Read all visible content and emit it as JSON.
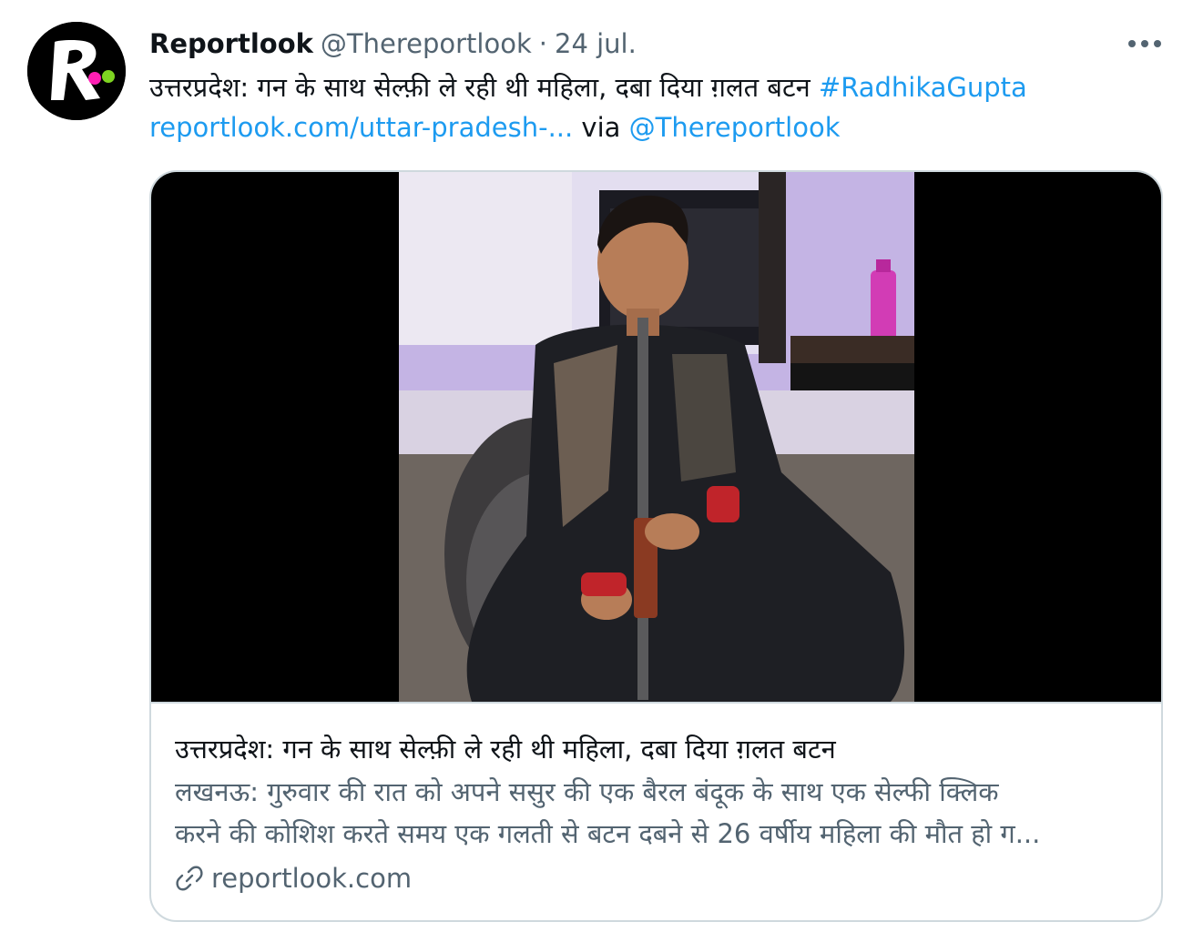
{
  "tweet": {
    "display_name": "Reportlook",
    "handle": "@Thereportlook",
    "separator": "·",
    "date": "24 jul.",
    "text_line1_plain": "उत्तरप्रदेश: गन के साथ सेल्फ़ी ले रही थी महिला, दबा दिया ग़लत बटन ",
    "text_line1_hashtag": "#RadhikaGupta",
    "text_line2_link": "reportlook.com/uttar-pradesh-...",
    "text_line2_via": " via ",
    "text_line2_mention": "@Thereportlook"
  },
  "card": {
    "title": "उत्तरप्रदेश: गन के साथ सेल्फ़ी ले रही थी महिला, दबा दिया ग़लत बटन",
    "description_line1": "लखनऊ: गुरुवार की रात को अपने ससुर की एक बैरल बंदूक के साथ एक सेल्फी क्लिक",
    "description_line2": "करने की कोशिश करते समय एक गलती से बटन दबने से 26 वर्षीय महिला की मौत हो ग...",
    "domain": "reportlook.com"
  },
  "icons": {
    "avatar_logo": "reportlook-logo-icon",
    "more": "more-horizontal-icon",
    "link": "link-icon"
  },
  "colors": {
    "link_blue": "#1d9bf0",
    "secondary_text": "#536471",
    "border": "#cfd9de",
    "logo_pink": "#ff1fb4",
    "logo_green": "#7ed321"
  }
}
